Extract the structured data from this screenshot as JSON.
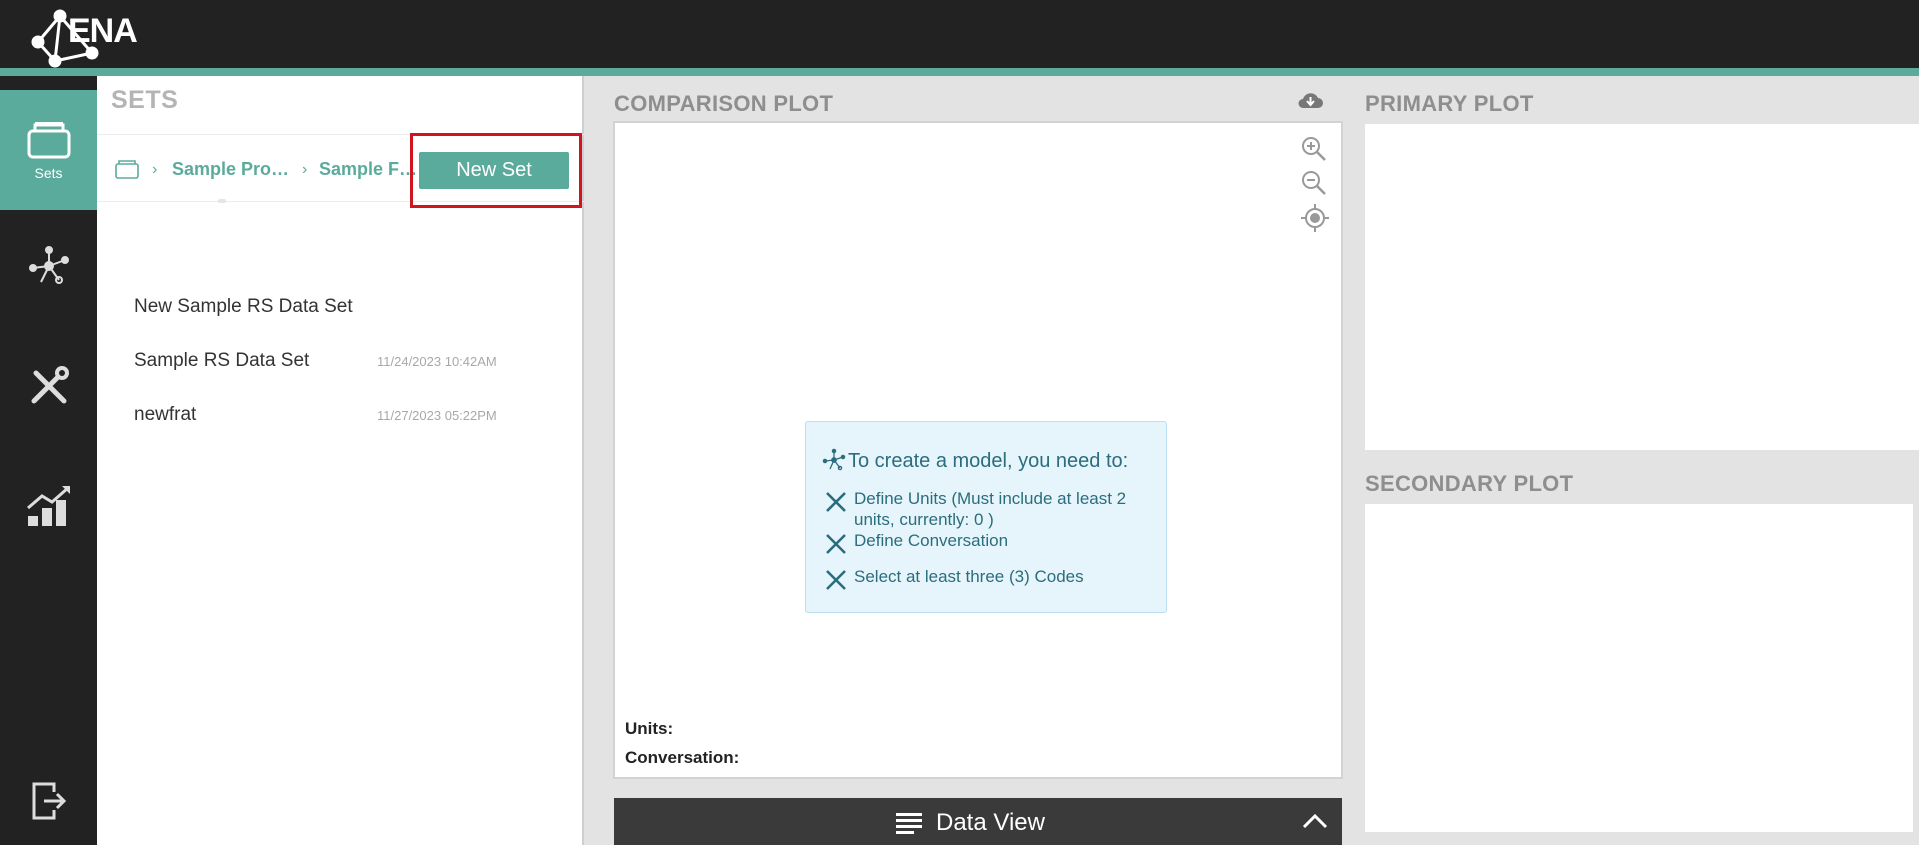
{
  "app": {
    "logo_text": "ENA"
  },
  "leftnav": {
    "items": [
      {
        "label": "Sets",
        "icon": "sets-icon",
        "active": true
      },
      {
        "label": "",
        "icon": "network-icon",
        "active": false
      },
      {
        "label": "",
        "icon": "tools-icon",
        "active": false
      },
      {
        "label": "",
        "icon": "chart-icon",
        "active": false
      },
      {
        "label": "",
        "icon": "logout-icon",
        "active": false
      }
    ]
  },
  "sets": {
    "title": "SETS",
    "breadcrumb": [
      "Sample Pro…",
      "Sample F…"
    ],
    "new_set_label": "New Set",
    "items": [
      {
        "name": "New Sample RS Data Set",
        "date": ""
      },
      {
        "name": "Sample RS Data Set",
        "date": "11/24/2023 10:42AM"
      },
      {
        "name": "newfrat",
        "date": "11/27/2023 05:22PM"
      }
    ]
  },
  "comparison": {
    "title": "COMPARISON PLOT",
    "model_info": {
      "title": "To create a model, you need to:",
      "requirements": [
        "Define Units (Must include at least 2 units, currently: 0 )",
        "Define Conversation",
        "Select at least three (3) Codes"
      ]
    },
    "units_label": "Units:",
    "conversation_label": "Conversation:"
  },
  "data_view": {
    "label": "Data View"
  },
  "primary": {
    "title": "PRIMARY PLOT"
  },
  "secondary": {
    "title": "SECONDARY PLOT"
  },
  "colors": {
    "accent": "#5bab9c",
    "dark": "#222222",
    "highlight": "#d0151f"
  }
}
